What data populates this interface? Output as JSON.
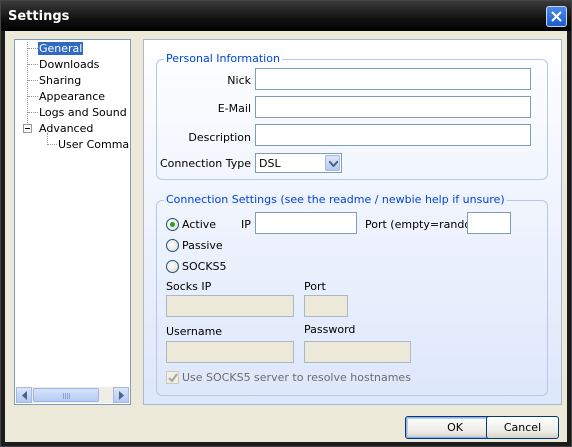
{
  "window": {
    "title": "Settings"
  },
  "tree": {
    "items": [
      {
        "label": "General",
        "selected": true
      },
      {
        "label": "Downloads"
      },
      {
        "label": "Sharing"
      },
      {
        "label": "Appearance"
      },
      {
        "label": "Logs and Sound"
      },
      {
        "label": "Advanced",
        "expanded": true
      },
      {
        "label": "User Commands",
        "visible_text": "User Comman"
      }
    ]
  },
  "personal": {
    "legend": "Personal Information",
    "nick_label": "Nick",
    "nick_value": "",
    "email_label": "E-Mail",
    "email_value": "",
    "description_label": "Description",
    "description_value": "",
    "connection_type_label": "Connection Type",
    "connection_type_value": "DSL"
  },
  "connection": {
    "legend": "Connection Settings (see the readme / newbie help if unsure)",
    "mode_options": [
      {
        "label": "Active",
        "checked": true
      },
      {
        "label": "Passive",
        "checked": false
      },
      {
        "label": "SOCKS5",
        "checked": false
      }
    ],
    "ip_label": "IP",
    "ip_value": "",
    "port_label": "Port (empty=random)",
    "port_value": "",
    "socks_ip_label": "Socks IP",
    "socks_ip_value": "",
    "socks_port_label": "Port",
    "socks_port_value": "",
    "username_label": "Username",
    "username_value": "",
    "password_label": "Password",
    "password_value": "",
    "resolve_label": "Use SOCKS5 server to resolve hostnames",
    "resolve_checked": true
  },
  "buttons": {
    "ok": "OK",
    "cancel": "Cancel"
  },
  "colors": {
    "accent": "#316ac5",
    "legend": "#0046d5",
    "titlebar": "#000000"
  }
}
